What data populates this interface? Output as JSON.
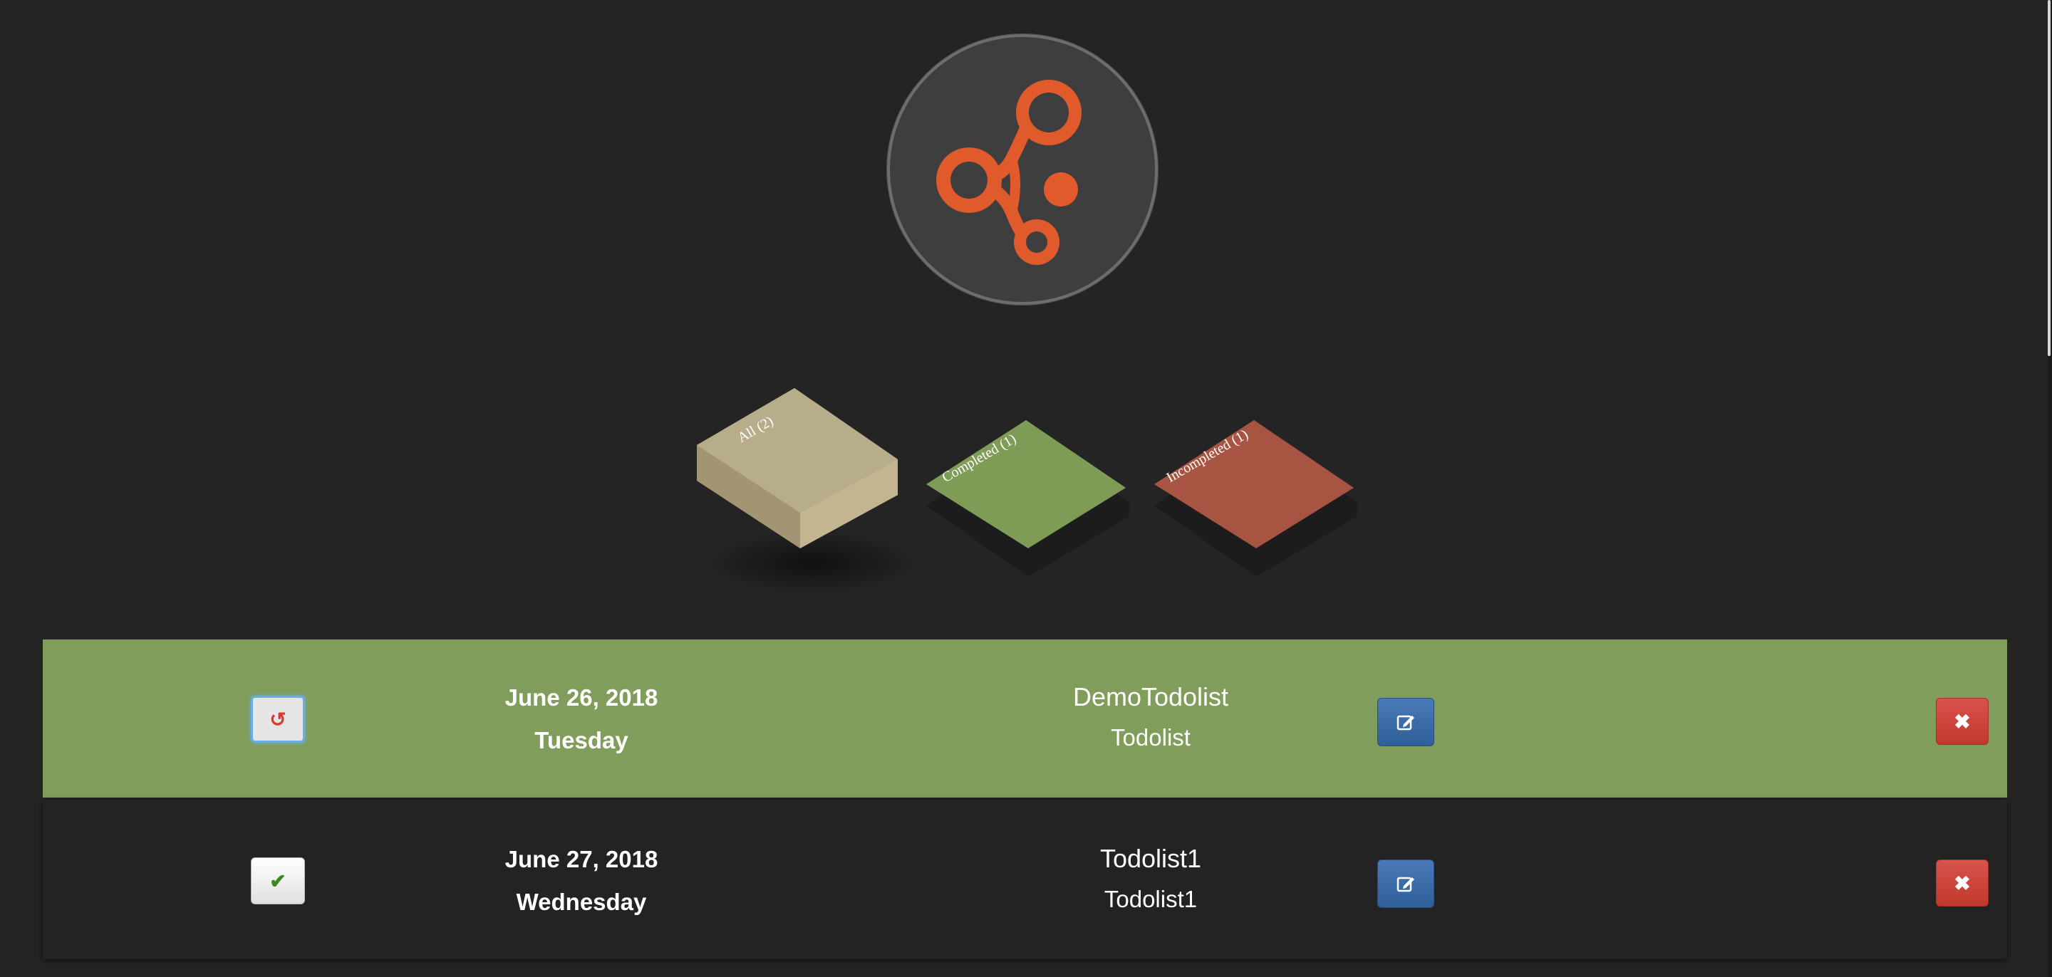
{
  "app": {
    "logo": {
      "icon": "molecule-logo-icon",
      "color": "#e05a2b"
    }
  },
  "filters": [
    {
      "label": "All (2)",
      "color": "#b8ad8a"
    },
    {
      "label": "Completed (1)",
      "color": "#7f9c57"
    },
    {
      "label": "Incompleted (1)",
      "color": "#a85442"
    }
  ],
  "todos": [
    {
      "date": "June 26, 2018",
      "day": "Tuesday",
      "title": "DemoTodolist",
      "description": "Todolist",
      "completed": true,
      "toggle_icon": "undo-icon",
      "toggle_glyph": "↺",
      "edit_icon": "edit-icon",
      "delete_icon": "close-icon",
      "delete_glyph": "✖",
      "row_color": "#809d5b"
    },
    {
      "date": "June 27, 2018",
      "day": "Wednesday",
      "title": "Todolist1",
      "description": "Todolist1",
      "completed": false,
      "toggle_icon": "check-icon",
      "toggle_glyph": "✔",
      "edit_icon": "edit-icon",
      "delete_icon": "close-icon",
      "delete_glyph": "✖",
      "row_color": "#232323"
    }
  ]
}
